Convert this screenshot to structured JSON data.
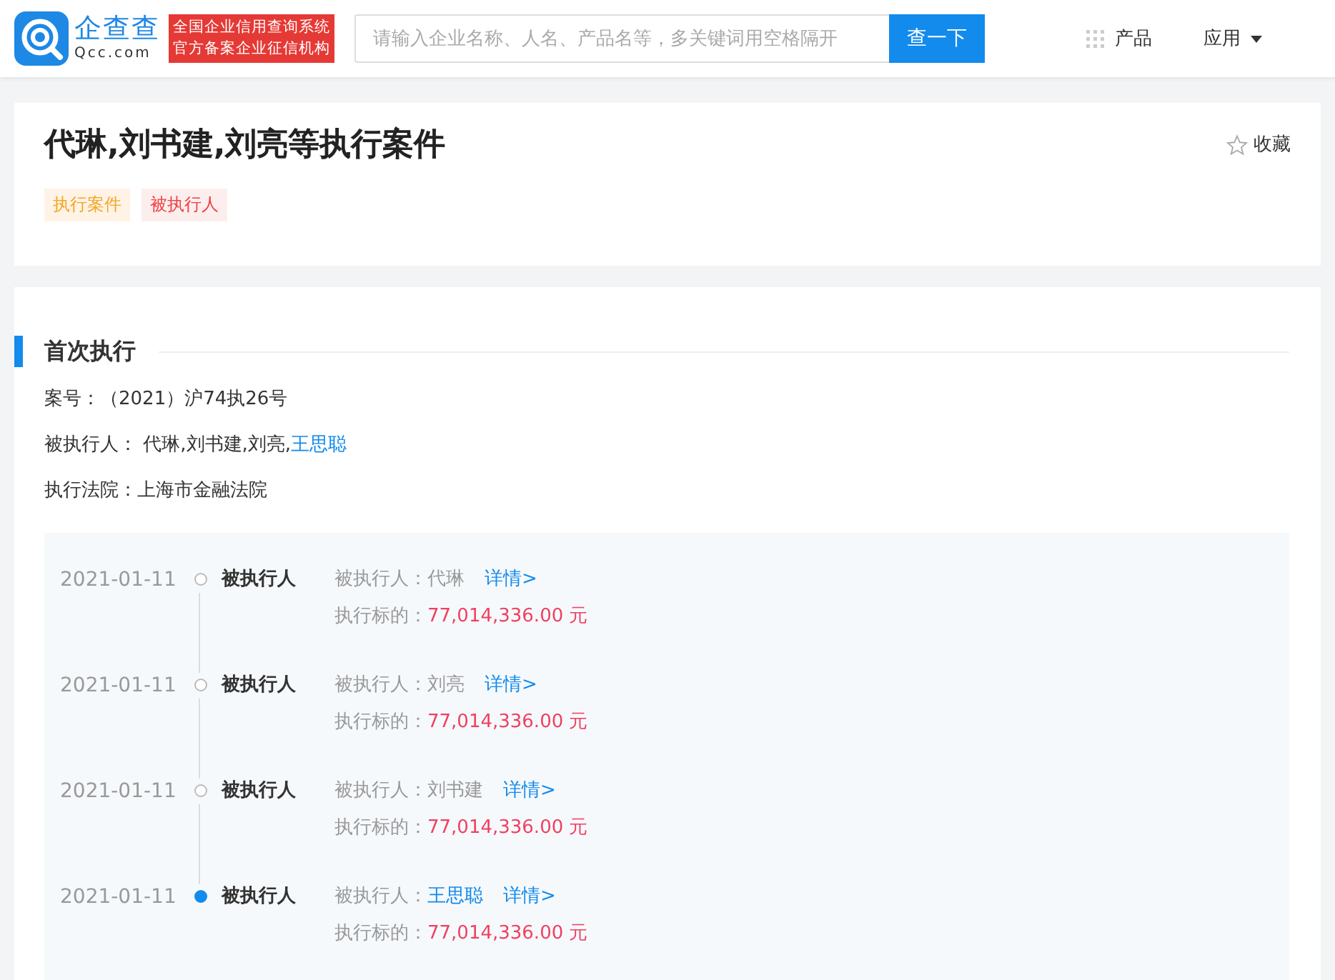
{
  "header": {
    "logo_name": "企查查",
    "logo_domain": "Qcc.com",
    "badge_lines": [
      "全国企业信用查询系统",
      "官方备案企业征信机构"
    ],
    "search": {
      "placeholder": "请输入企业名称、人名、产品名等，多关键词用空格隔开"
    },
    "search_button": "查一下",
    "nav": [
      {
        "label": "产品",
        "kind": "grid"
      },
      {
        "label": "应用",
        "kind": "dropdown"
      }
    ]
  },
  "case": {
    "title": "代琳,刘书建,刘亮等执行案件",
    "favorite": "收藏",
    "tags": [
      {
        "label": "执行案件",
        "kind": "orange"
      },
      {
        "label": "被执行人",
        "kind": "red"
      }
    ]
  },
  "section": {
    "title": "首次执行",
    "fields": [
      {
        "label": "案号：",
        "parts": [
          {
            "text": "（2021）沪74执26号",
            "link": false
          }
        ]
      },
      {
        "label": "被执行人： ",
        "parts": [
          {
            "text": "代琳,刘书建,刘亮,",
            "link": false
          },
          {
            "text": "王思聪",
            "link": true
          }
        ]
      },
      {
        "label": "执行法院：",
        "parts": [
          {
            "text": "上海市金融法院",
            "link": false
          }
        ]
      }
    ],
    "timeline": [
      {
        "date": "2021-01-11",
        "role": "被执行人",
        "name_label": "被执行人：",
        "name": "代琳",
        "name_link": false,
        "detail": "详情>",
        "amount_label": "执行标的：",
        "amount": "77,014,336.00 元",
        "selected": false
      },
      {
        "date": "2021-01-11",
        "role": "被执行人",
        "name_label": "被执行人：",
        "name": "刘亮",
        "name_link": false,
        "detail": "详情>",
        "amount_label": "执行标的：",
        "amount": "77,014,336.00 元",
        "selected": false
      },
      {
        "date": "2021-01-11",
        "role": "被执行人",
        "name_label": "被执行人：",
        "name": "刘书建",
        "name_link": false,
        "detail": "详情>",
        "amount_label": "执行标的：",
        "amount": "77,014,336.00 元",
        "selected": false
      },
      {
        "date": "2021-01-11",
        "role": "被执行人",
        "name_label": "被执行人：",
        "name": "王思聪",
        "name_link": true,
        "detail": "详情>",
        "amount_label": "执行标的：",
        "amount": "77,014,336.00 元",
        "selected": true
      }
    ]
  }
}
